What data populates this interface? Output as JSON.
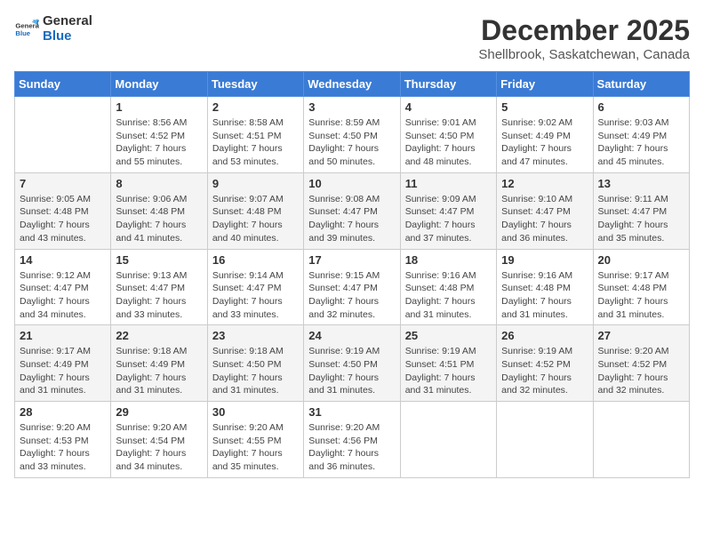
{
  "header": {
    "logo_line1": "General",
    "logo_line2": "Blue",
    "month_title": "December 2025",
    "subtitle": "Shellbrook, Saskatchewan, Canada"
  },
  "weekdays": [
    "Sunday",
    "Monday",
    "Tuesday",
    "Wednesday",
    "Thursday",
    "Friday",
    "Saturday"
  ],
  "weeks": [
    [
      {
        "day": "",
        "sunrise": "",
        "sunset": "",
        "daylight": ""
      },
      {
        "day": "1",
        "sunrise": "8:56 AM",
        "sunset": "4:52 PM",
        "daylight": "7 hours and 55 minutes."
      },
      {
        "day": "2",
        "sunrise": "8:58 AM",
        "sunset": "4:51 PM",
        "daylight": "7 hours and 53 minutes."
      },
      {
        "day": "3",
        "sunrise": "8:59 AM",
        "sunset": "4:50 PM",
        "daylight": "7 hours and 50 minutes."
      },
      {
        "day": "4",
        "sunrise": "9:01 AM",
        "sunset": "4:50 PM",
        "daylight": "7 hours and 48 minutes."
      },
      {
        "day": "5",
        "sunrise": "9:02 AM",
        "sunset": "4:49 PM",
        "daylight": "7 hours and 47 minutes."
      },
      {
        "day": "6",
        "sunrise": "9:03 AM",
        "sunset": "4:49 PM",
        "daylight": "7 hours and 45 minutes."
      }
    ],
    [
      {
        "day": "7",
        "sunrise": "9:05 AM",
        "sunset": "4:48 PM",
        "daylight": "7 hours and 43 minutes."
      },
      {
        "day": "8",
        "sunrise": "9:06 AM",
        "sunset": "4:48 PM",
        "daylight": "7 hours and 41 minutes."
      },
      {
        "day": "9",
        "sunrise": "9:07 AM",
        "sunset": "4:48 PM",
        "daylight": "7 hours and 40 minutes."
      },
      {
        "day": "10",
        "sunrise": "9:08 AM",
        "sunset": "4:47 PM",
        "daylight": "7 hours and 39 minutes."
      },
      {
        "day": "11",
        "sunrise": "9:09 AM",
        "sunset": "4:47 PM",
        "daylight": "7 hours and 37 minutes."
      },
      {
        "day": "12",
        "sunrise": "9:10 AM",
        "sunset": "4:47 PM",
        "daylight": "7 hours and 36 minutes."
      },
      {
        "day": "13",
        "sunrise": "9:11 AM",
        "sunset": "4:47 PM",
        "daylight": "7 hours and 35 minutes."
      }
    ],
    [
      {
        "day": "14",
        "sunrise": "9:12 AM",
        "sunset": "4:47 PM",
        "daylight": "7 hours and 34 minutes."
      },
      {
        "day": "15",
        "sunrise": "9:13 AM",
        "sunset": "4:47 PM",
        "daylight": "7 hours and 33 minutes."
      },
      {
        "day": "16",
        "sunrise": "9:14 AM",
        "sunset": "4:47 PM",
        "daylight": "7 hours and 33 minutes."
      },
      {
        "day": "17",
        "sunrise": "9:15 AM",
        "sunset": "4:47 PM",
        "daylight": "7 hours and 32 minutes."
      },
      {
        "day": "18",
        "sunrise": "9:16 AM",
        "sunset": "4:48 PM",
        "daylight": "7 hours and 31 minutes."
      },
      {
        "day": "19",
        "sunrise": "9:16 AM",
        "sunset": "4:48 PM",
        "daylight": "7 hours and 31 minutes."
      },
      {
        "day": "20",
        "sunrise": "9:17 AM",
        "sunset": "4:48 PM",
        "daylight": "7 hours and 31 minutes."
      }
    ],
    [
      {
        "day": "21",
        "sunrise": "9:17 AM",
        "sunset": "4:49 PM",
        "daylight": "7 hours and 31 minutes."
      },
      {
        "day": "22",
        "sunrise": "9:18 AM",
        "sunset": "4:49 PM",
        "daylight": "7 hours and 31 minutes."
      },
      {
        "day": "23",
        "sunrise": "9:18 AM",
        "sunset": "4:50 PM",
        "daylight": "7 hours and 31 minutes."
      },
      {
        "day": "24",
        "sunrise": "9:19 AM",
        "sunset": "4:50 PM",
        "daylight": "7 hours and 31 minutes."
      },
      {
        "day": "25",
        "sunrise": "9:19 AM",
        "sunset": "4:51 PM",
        "daylight": "7 hours and 31 minutes."
      },
      {
        "day": "26",
        "sunrise": "9:19 AM",
        "sunset": "4:52 PM",
        "daylight": "7 hours and 32 minutes."
      },
      {
        "day": "27",
        "sunrise": "9:20 AM",
        "sunset": "4:52 PM",
        "daylight": "7 hours and 32 minutes."
      }
    ],
    [
      {
        "day": "28",
        "sunrise": "9:20 AM",
        "sunset": "4:53 PM",
        "daylight": "7 hours and 33 minutes."
      },
      {
        "day": "29",
        "sunrise": "9:20 AM",
        "sunset": "4:54 PM",
        "daylight": "7 hours and 34 minutes."
      },
      {
        "day": "30",
        "sunrise": "9:20 AM",
        "sunset": "4:55 PM",
        "daylight": "7 hours and 35 minutes."
      },
      {
        "day": "31",
        "sunrise": "9:20 AM",
        "sunset": "4:56 PM",
        "daylight": "7 hours and 36 minutes."
      },
      {
        "day": "",
        "sunrise": "",
        "sunset": "",
        "daylight": ""
      },
      {
        "day": "",
        "sunrise": "",
        "sunset": "",
        "daylight": ""
      },
      {
        "day": "",
        "sunrise": "",
        "sunset": "",
        "daylight": ""
      }
    ]
  ],
  "labels": {
    "sunrise_prefix": "Sunrise: ",
    "sunset_prefix": "Sunset: ",
    "daylight_prefix": "Daylight: "
  }
}
